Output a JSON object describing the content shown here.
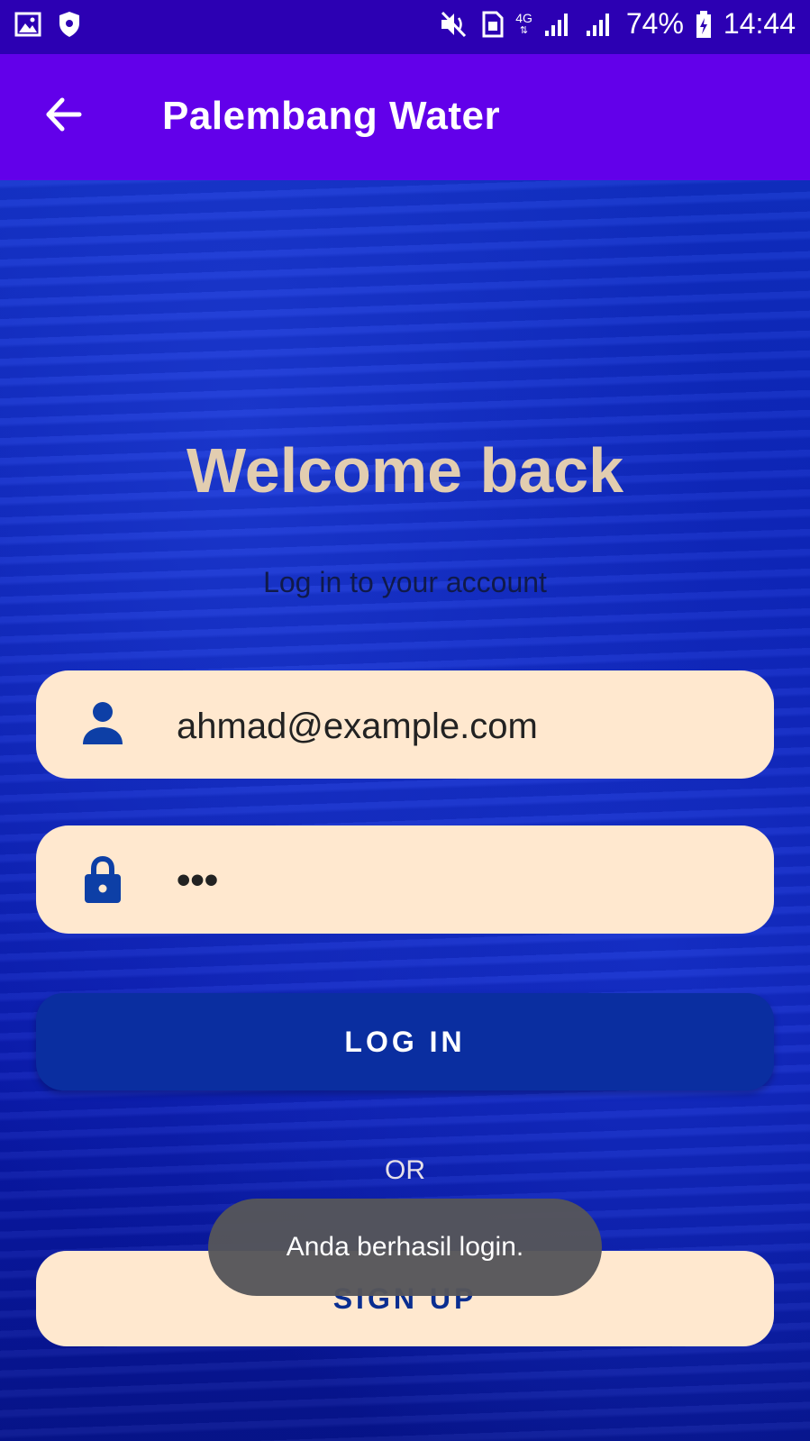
{
  "status_bar": {
    "network": "4G",
    "battery": "74%",
    "time": "14:44",
    "icons": [
      "gallery-icon",
      "shield-icon",
      "mute-icon",
      "sim-icon",
      "signal-icon",
      "battery-icon"
    ]
  },
  "app_bar": {
    "title": "Palembang Water",
    "back_icon": "arrow-left-icon"
  },
  "login": {
    "heading": "Welcome back",
    "subtitle": "Log in to your account",
    "email_value": "ahmad@example.com",
    "email_icon": "person-icon",
    "password_value": "•••",
    "password_icon": "lock-icon",
    "login_label": "LOG IN",
    "or_label": "OR",
    "signup_label": "SIGN UP"
  },
  "toast": {
    "message": "Anda berhasil login."
  },
  "colors": {
    "status_bar": "#2c00b3",
    "app_bar": "#6200ea",
    "heading": "#e2cdb0",
    "field_bg": "#ffe8cf",
    "login_button": "#0a2ea0",
    "icon_blue": "#0d3fa6"
  }
}
